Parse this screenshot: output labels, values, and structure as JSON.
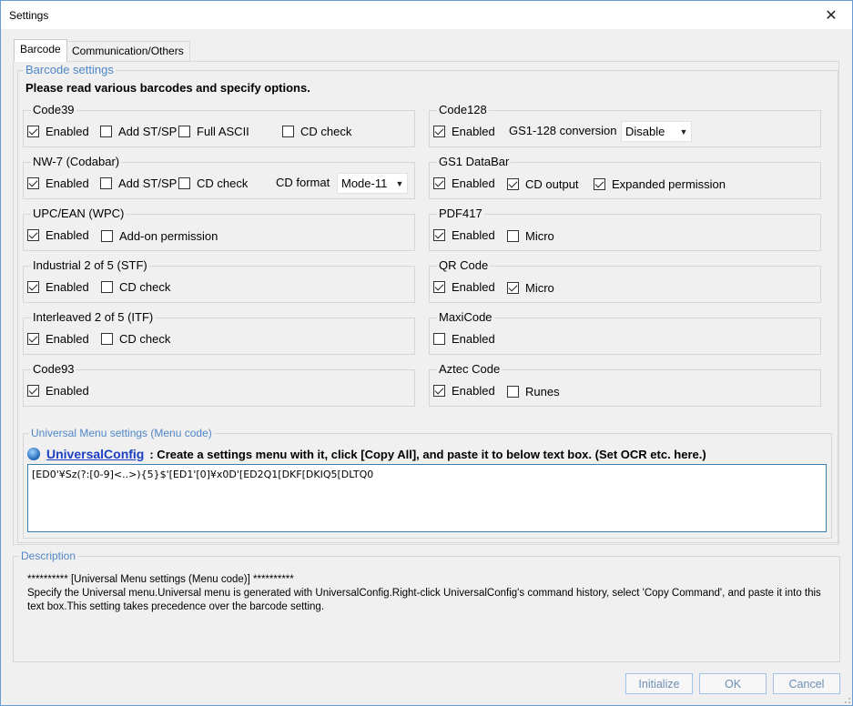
{
  "window": {
    "title": "Settings"
  },
  "tabs": [
    {
      "label": "Barcode"
    },
    {
      "label": "Communication/Others"
    }
  ],
  "barcode_settings": {
    "title": "Barcode settings",
    "intro": "Please read various barcodes and specify options.",
    "groups": {
      "code39": {
        "title": "Code39",
        "enabled": {
          "label": "Enabled",
          "checked": true
        },
        "add_st_sp": {
          "label": "Add ST/SP",
          "checked": false
        },
        "full_ascii": {
          "label": "Full ASCII",
          "checked": false
        },
        "cd_check": {
          "label": "CD check",
          "checked": false
        }
      },
      "nw7": {
        "title": "NW-7 (Codabar)",
        "enabled": {
          "label": "Enabled",
          "checked": true
        },
        "add_st_sp": {
          "label": "Add ST/SP",
          "checked": false
        },
        "cd_check": {
          "label": "CD check",
          "checked": false
        },
        "cd_format_label": "CD format",
        "cd_format_value": "Mode-11"
      },
      "upcean": {
        "title": "UPC/EAN (WPC)",
        "enabled": {
          "label": "Enabled",
          "checked": true
        },
        "addon": {
          "label": "Add-on permission",
          "checked": false
        }
      },
      "industrial25": {
        "title": "Industrial 2 of 5 (STF)",
        "enabled": {
          "label": "Enabled",
          "checked": true
        },
        "cd_check": {
          "label": "CD check",
          "checked": false
        }
      },
      "interleaved25": {
        "title": "Interleaved 2 of 5 (ITF)",
        "enabled": {
          "label": "Enabled",
          "checked": true
        },
        "cd_check": {
          "label": "CD check",
          "checked": false
        }
      },
      "code93": {
        "title": "Code93",
        "enabled": {
          "label": "Enabled",
          "checked": true
        }
      },
      "code128": {
        "title": "Code128",
        "enabled": {
          "label": "Enabled",
          "checked": true
        },
        "gs1_label": "GS1-128 conversion",
        "gs1_value": "Disable"
      },
      "gs1databar": {
        "title": "GS1 DataBar",
        "enabled": {
          "label": "Enabled",
          "checked": true
        },
        "cd_output": {
          "label": "CD output",
          "checked": true
        },
        "expanded": {
          "label": "Expanded permission",
          "checked": true
        }
      },
      "pdf417": {
        "title": "PDF417",
        "enabled": {
          "label": "Enabled",
          "checked": true
        },
        "micro": {
          "label": "Micro",
          "checked": false
        }
      },
      "qrcode": {
        "title": "QR Code",
        "enabled": {
          "label": "Enabled",
          "checked": true
        },
        "micro": {
          "label": "Micro",
          "checked": true
        }
      },
      "maxicode": {
        "title": "MaxiCode",
        "enabled": {
          "label": "Enabled",
          "checked": false
        }
      },
      "aztec": {
        "title": "Aztec Code",
        "enabled": {
          "label": "Enabled",
          "checked": true
        },
        "runes": {
          "label": "Runes",
          "checked": false
        }
      }
    }
  },
  "universal_menu": {
    "title": "Universal Menu settings (Menu code)",
    "link_label": "UniversalConfig",
    "instruction": ": Create a settings menu with it, click [Copy All], and paste it to below text box. (Set OCR etc. here.)",
    "value": "[ED0'¥Sz(?:[0-9]<..>){5}$'[ED1'[0]¥x0D'[ED2Q1[DKF[DKIQ5[DLTQ0"
  },
  "description": {
    "title": "Description",
    "line1": "**********  [Universal Menu settings (Menu code)]  **********",
    "line2": "Specify the Universal menu.Universal menu is generated with UniversalConfig.Right-click UniversalConfig's command history, select 'Copy Command', and paste it into this text box.This setting takes precedence over the barcode setting."
  },
  "buttons": {
    "initialize": "Initialize",
    "ok": "OK",
    "cancel": "Cancel"
  }
}
